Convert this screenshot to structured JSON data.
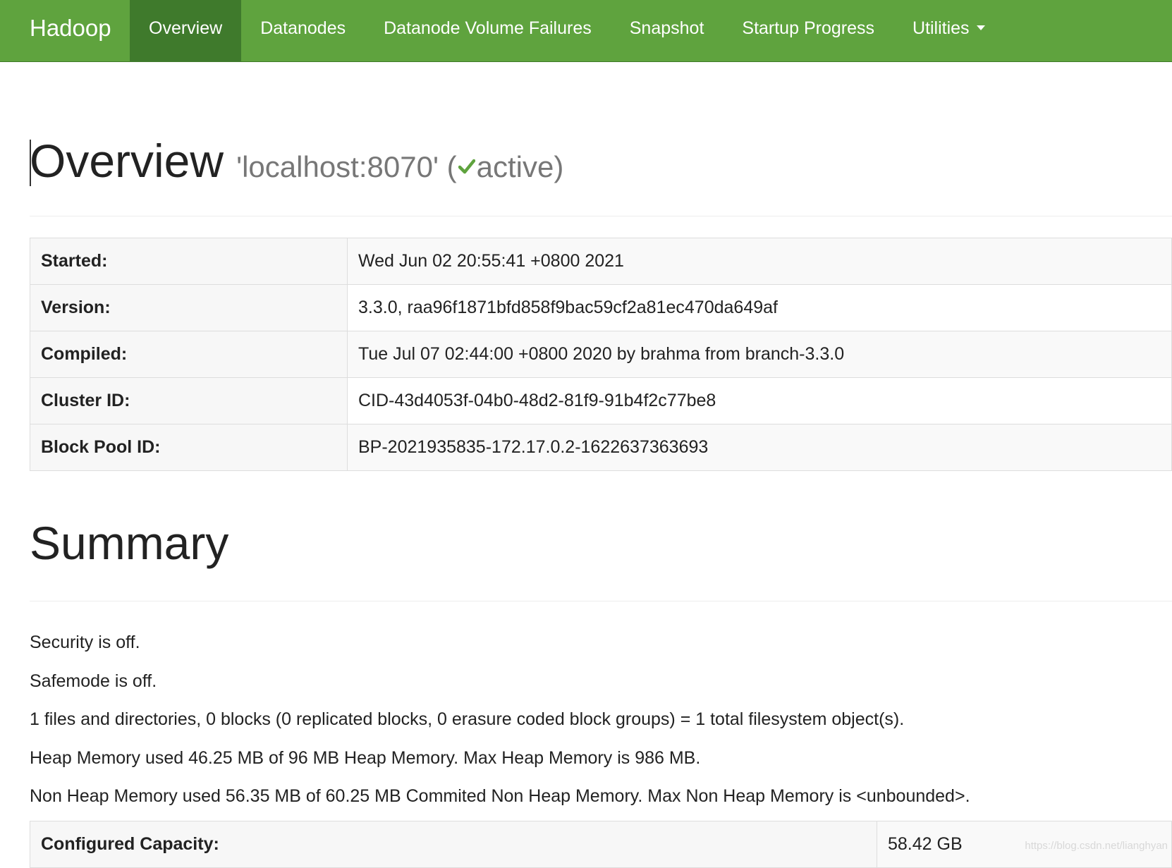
{
  "navbar": {
    "brand": "Hadoop",
    "items": [
      {
        "label": "Overview",
        "active": true
      },
      {
        "label": "Datanodes"
      },
      {
        "label": "Datanode Volume Failures"
      },
      {
        "label": "Snapshot"
      },
      {
        "label": "Startup Progress"
      },
      {
        "label": "Utilities"
      }
    ]
  },
  "overview": {
    "title": "Overview",
    "host": "'localhost:8070'",
    "paren_open": "(",
    "status": "active",
    "paren_close": ")",
    "status_icon": "check-icon",
    "status_color": "#5fa33e"
  },
  "info_table": [
    {
      "label": "Started:",
      "value": "Wed Jun 02 20:55:41 +0800 2021"
    },
    {
      "label": "Version:",
      "value": "3.3.0, raa96f1871bfd858f9bac59cf2a81ec470da649af"
    },
    {
      "label": "Compiled:",
      "value": "Tue Jul 07 02:44:00 +0800 2020 by brahma from branch-3.3.0"
    },
    {
      "label": "Cluster ID:",
      "value": "CID-43d4053f-04b0-48d2-81f9-91b4f2c77be8"
    },
    {
      "label": "Block Pool ID:",
      "value": "BP-2021935835-172.17.0.2-1622637363693"
    }
  ],
  "summary": {
    "title": "Summary",
    "lines": [
      "Security is off.",
      "Safemode is off.",
      "1 files and directories, 0 blocks (0 replicated blocks, 0 erasure coded block groups) = 1 total filesystem object(s).",
      "Heap Memory used 46.25 MB of 96 MB Heap Memory. Max Heap Memory is 986 MB.",
      "Non Heap Memory used 56.35 MB of 60.25 MB Commited Non Heap Memory. Max Non Heap Memory is <unbounded>."
    ],
    "table": [
      {
        "label": "Configured Capacity:",
        "value": "58.42 GB"
      }
    ]
  },
  "watermark": "https://blog.csdn.net/lianghyan",
  "colors": {
    "navbar": "#5fa33e",
    "navbar_active": "#3f7a2c"
  }
}
